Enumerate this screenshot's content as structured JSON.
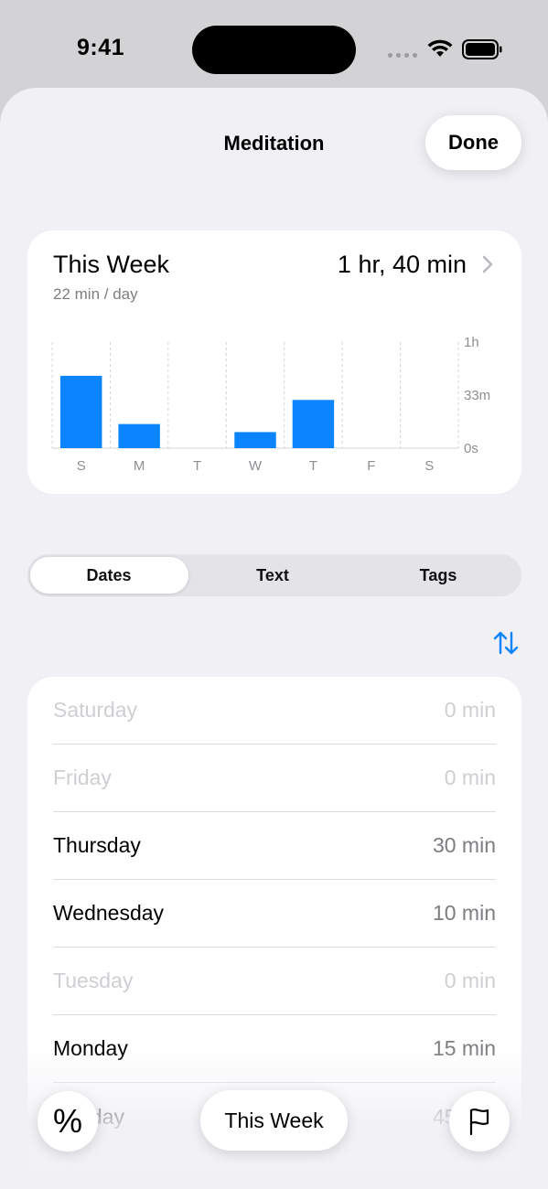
{
  "status_bar": {
    "time": "9:41"
  },
  "nav": {
    "title": "Meditation",
    "done_label": "Done"
  },
  "summary": {
    "title": "This Week",
    "total": "1 hr, 40 min",
    "average": "22 min / day"
  },
  "chart_data": {
    "type": "bar",
    "categories": [
      "S",
      "M",
      "T",
      "W",
      "T",
      "F",
      "S"
    ],
    "values": [
      45,
      15,
      0,
      10,
      30,
      0,
      0
    ],
    "unit": "min",
    "ylim": [
      0,
      66
    ],
    "yticks": [
      {
        "value": 66,
        "label": "1h"
      },
      {
        "value": 33,
        "label": "33m"
      },
      {
        "value": 0,
        "label": "0s"
      }
    ],
    "grid": true,
    "color": "#0a84ff"
  },
  "segments": {
    "items": [
      "Dates",
      "Text",
      "Tags"
    ],
    "selected": "Dates"
  },
  "list": [
    {
      "day": "Saturday",
      "value": "0 min",
      "dim": true
    },
    {
      "day": "Friday",
      "value": "0 min",
      "dim": true
    },
    {
      "day": "Thursday",
      "value": "30 min",
      "dim": false
    },
    {
      "day": "Wednesday",
      "value": "10 min",
      "dim": false
    },
    {
      "day": "Tuesday",
      "value": "0 min",
      "dim": true
    },
    {
      "day": "Monday",
      "value": "15 min",
      "dim": false
    },
    {
      "day": "Sunday",
      "value": "45 min",
      "dim": false
    }
  ],
  "bottom_bar": {
    "percent_label": "%",
    "range_label": "This Week",
    "flag_icon": "flag-icon"
  },
  "colors": {
    "accent": "#0a84ff",
    "background": "#f0f0f5"
  }
}
